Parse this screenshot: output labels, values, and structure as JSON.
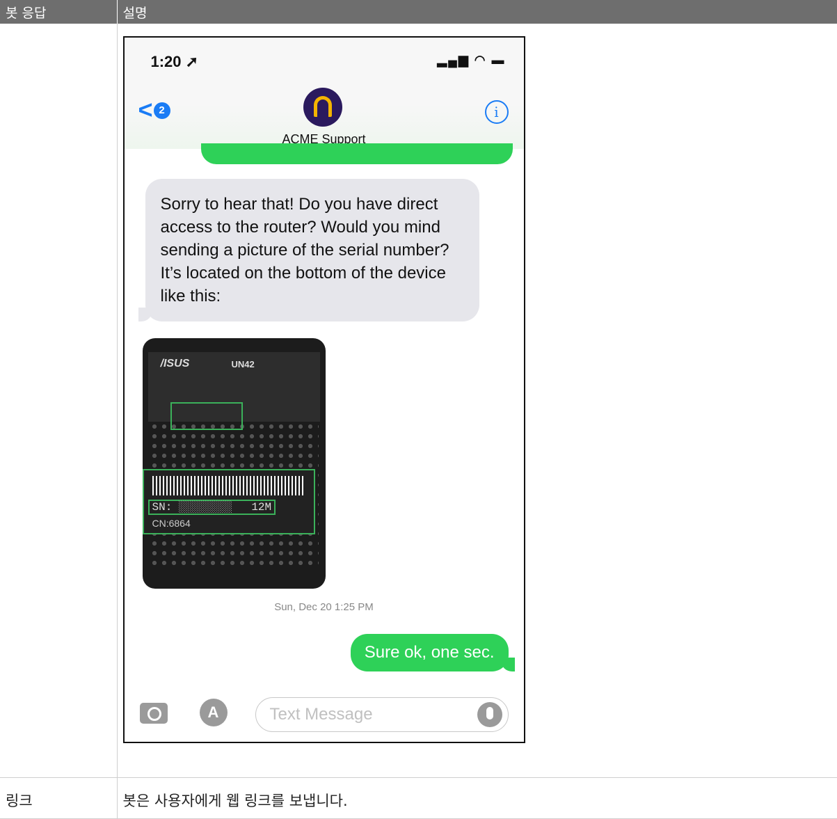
{
  "table": {
    "headers": [
      "봇 응답",
      "설명"
    ],
    "rows": [
      {
        "response": "",
        "description": ""
      },
      {
        "response": "링크",
        "description": "봇은 사용자에게 웹 링크를 보냅니다."
      }
    ]
  },
  "phone": {
    "status_time": "1:20",
    "status_icons": "signal-wifi-battery",
    "back_badge": "2",
    "contact_name": "ACME Support",
    "info_icon": "i",
    "incoming_message": "Sorry to hear that! Do you have direct access to the router? Would you mind sending a picture of the serial number? It’s located on the bottom of the device like this:",
    "photo": {
      "brand": "/ISUS",
      "model": "UN42",
      "sn_label": "SN:",
      "suffix": "12M",
      "cn_label": "CN:6864"
    },
    "timestamp": "Sun, Dec 20 1:25 PM",
    "outgoing_message": "Sure ok, one sec.",
    "input_placeholder": "Text Message"
  }
}
